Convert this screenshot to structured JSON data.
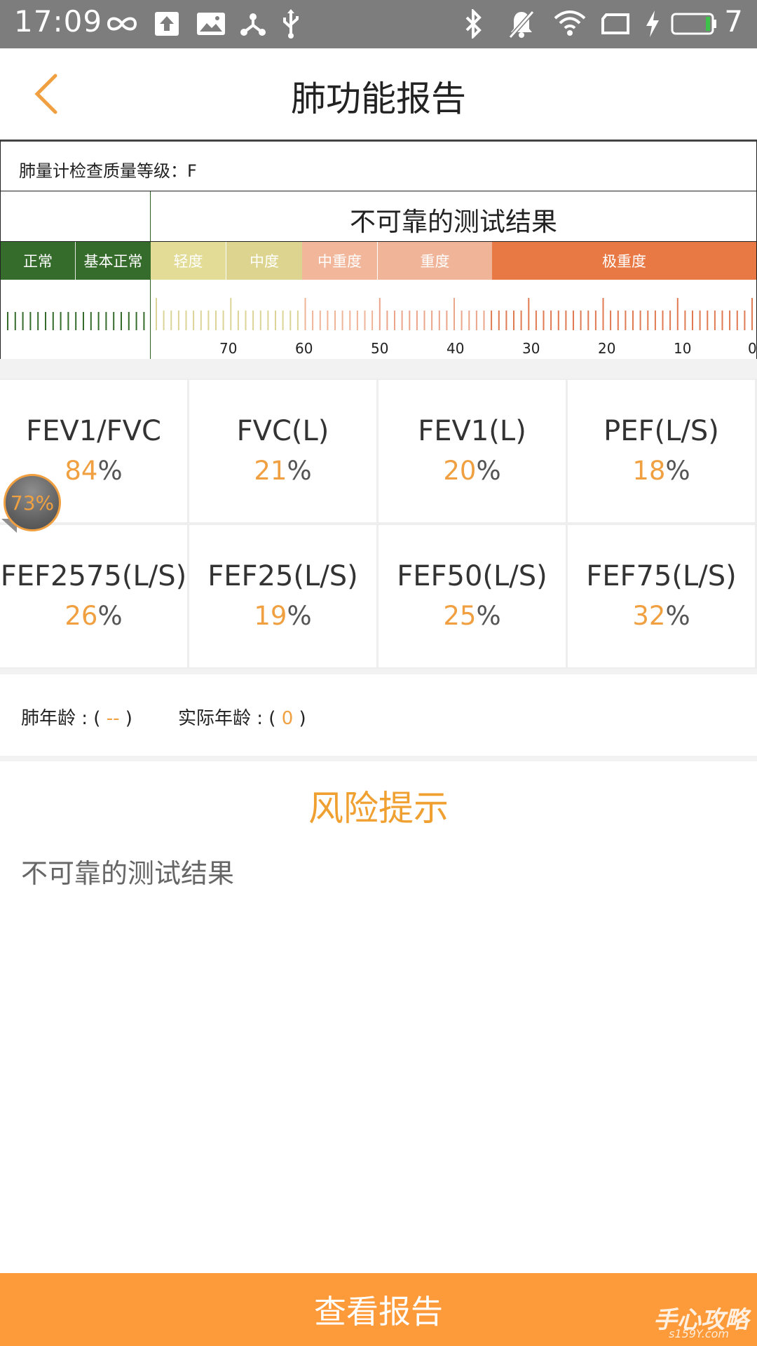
{
  "status_bar": {
    "time": "17:09",
    "battery_level": "7",
    "icons": [
      "infinity-icon",
      "upload-icon",
      "image-icon",
      "share-network-icon",
      "usb-icon",
      "bluetooth-icon",
      "bell-off-icon",
      "wifi-icon",
      "screen-rotate-icon",
      "charging-icon",
      "battery-icon"
    ]
  },
  "header": {
    "title": "肺功能报告",
    "back_icon": "chevron-left-icon"
  },
  "quality": {
    "label": "肺量计检查质量等级：F"
  },
  "result": {
    "text": "不可靠的测试结果"
  },
  "severity_scale": {
    "segments": [
      {
        "label": "正常",
        "color": "#356b2b"
      },
      {
        "label": "基本正常",
        "color": "#356b2b"
      },
      {
        "label": "轻度",
        "color": "#e3dc97"
      },
      {
        "label": "中度",
        "color": "#ddd58f"
      },
      {
        "label": "中重度",
        "color": "#f2b79b"
      },
      {
        "label": "重度",
        "color": "#f0b498"
      },
      {
        "label": "极重度",
        "color": "#e97944"
      }
    ],
    "tick_labels": [
      "70",
      "60",
      "50",
      "40",
      "30",
      "20",
      "10",
      "0"
    ]
  },
  "metrics": [
    {
      "name": "FEV1/FVC",
      "value": "84",
      "unit": "%"
    },
    {
      "name": "FVC(L)",
      "value": "21",
      "unit": "%"
    },
    {
      "name": "FEV1(L)",
      "value": "20",
      "unit": "%"
    },
    {
      "name": "PEF(L/S)",
      "value": "18",
      "unit": "%"
    },
    {
      "name": "FEF2575(L/S)",
      "value": "26",
      "unit": "%"
    },
    {
      "name": "FEF25(L/S)",
      "value": "19",
      "unit": "%"
    },
    {
      "name": "FEF50(L/S)",
      "value": "25",
      "unit": "%"
    },
    {
      "name": "FEF75(L/S)",
      "value": "32",
      "unit": "%"
    }
  ],
  "floating_bubble": {
    "text": "73%"
  },
  "ages": {
    "lung_age_label": "肺年龄 : (",
    "lung_age_value": "--",
    "lung_age_close": ")",
    "actual_age_label": "实际年龄 : (",
    "actual_age_value": "0",
    "actual_age_close": ")"
  },
  "risk": {
    "title": "风险提示",
    "text": "不可靠的测试结果"
  },
  "bottom_button": {
    "label": "查看报告"
  },
  "watermark": {
    "text": "手心攻略",
    "sub": "s159Y.com"
  },
  "colors": {
    "accent": "#f0a040",
    "button": "#fd9a3a",
    "status_bar": "#7d7d7d"
  }
}
